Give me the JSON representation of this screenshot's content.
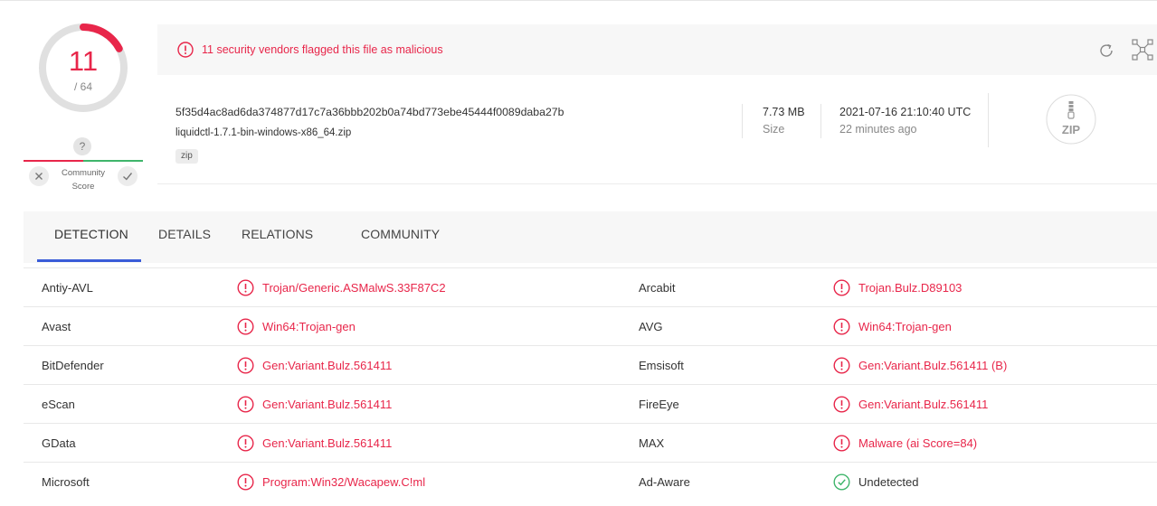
{
  "score": {
    "detected": "11",
    "total": "/ 64",
    "fraction": 0.171875,
    "color": "#e8264a"
  },
  "community": {
    "unknown_icon": "question-icon",
    "label_line1": "Community",
    "label_line2": "Score",
    "unknown": "?"
  },
  "alert": {
    "text": "11 security vendors flagged this file as malicious",
    "color": "#e8264a"
  },
  "file": {
    "hash": "5f35d4ac8ad6da374877d17c7a36bbb202b0a74bd773ebe45444f0089daba27b",
    "name": "liquidctl-1.7.1-bin-windows-x86_64.zip",
    "tag": "zip",
    "size": "7.73 MB",
    "size_label": "Size",
    "date": "2021-07-16 21:10:40 UTC",
    "ago": "22 minutes ago",
    "type_icon": "ZIP"
  },
  "tabs": [
    {
      "label": "DETECTION",
      "active": true
    },
    {
      "label": "DETAILS",
      "active": false
    },
    {
      "label": "RELATIONS",
      "active": false
    },
    {
      "label": "COMMUNITY",
      "active": false
    }
  ],
  "rows": [
    {
      "v1": "Antiy-AVL",
      "r1": "Trojan/Generic.ASMalwS.33F87C2",
      "d1": true,
      "v2": "Arcabit",
      "r2": "Trojan.Bulz.D89103",
      "d2": true
    },
    {
      "v1": "Avast",
      "r1": "Win64:Trojan-gen",
      "d1": true,
      "v2": "AVG",
      "r2": "Win64:Trojan-gen",
      "d2": true
    },
    {
      "v1": "BitDefender",
      "r1": "Gen:Variant.Bulz.561411",
      "d1": true,
      "v2": "Emsisoft",
      "r2": "Gen:Variant.Bulz.561411 (B)",
      "d2": true
    },
    {
      "v1": "eScan",
      "r1": "Gen:Variant.Bulz.561411",
      "d1": true,
      "v2": "FireEye",
      "r2": "Gen:Variant.Bulz.561411",
      "d2": true
    },
    {
      "v1": "GData",
      "r1": "Gen:Variant.Bulz.561411",
      "d1": true,
      "v2": "MAX",
      "r2": "Malware (ai Score=84)",
      "d2": true
    },
    {
      "v1": "Microsoft",
      "r1": "Program:Win32/Wacapew.C!ml",
      "d1": true,
      "v2": "Ad-Aware",
      "r2": "Undetected",
      "d2": false
    }
  ]
}
